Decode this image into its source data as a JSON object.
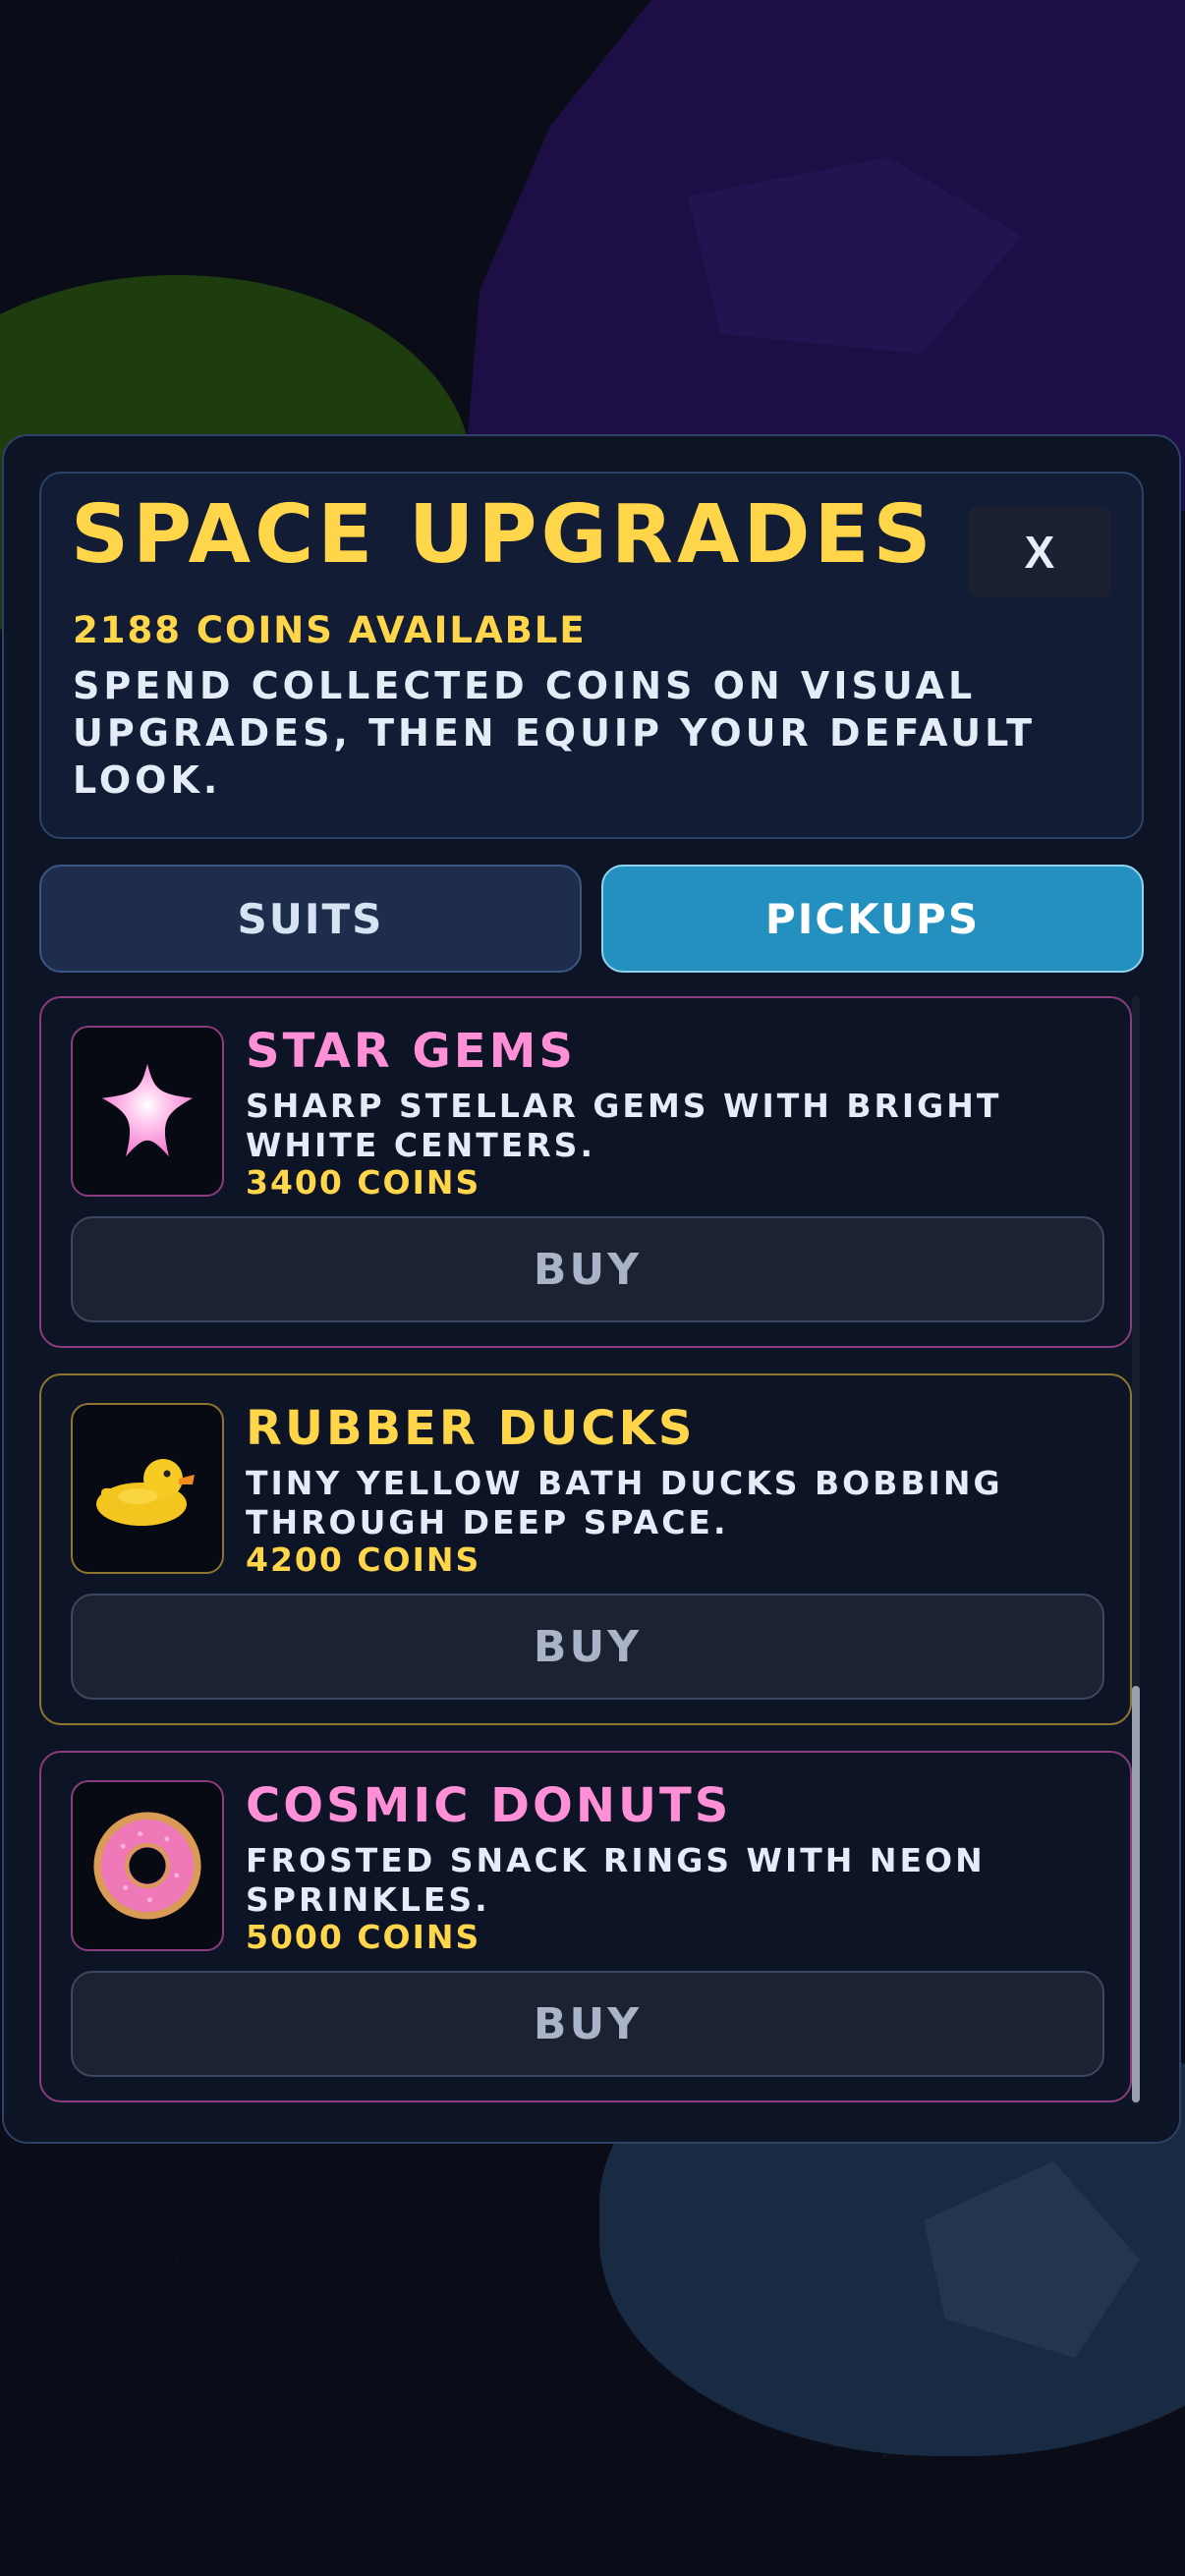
{
  "header": {
    "title": "SPACE UPGRADES",
    "close_label": "X",
    "coins_available": "2188 COINS AVAILABLE",
    "description": "SPEND COLLECTED COINS ON VISUAL UPGRADES, THEN EQUIP YOUR DEFAULT LOOK."
  },
  "tabs": [
    {
      "label": "SUITS",
      "active": false
    },
    {
      "label": "PICKUPS",
      "active": true
    }
  ],
  "items": [
    {
      "name": "STAR GEMS",
      "description": "SHARP STELLAR GEMS WITH BRIGHT WHITE CENTERS.",
      "price": "3400 COINS",
      "button_label": "BUY",
      "icon": "star-gem-icon",
      "accent": "#ff8fd6"
    },
    {
      "name": "RUBBER DUCKS",
      "description": "TINY YELLOW BATH DUCKS BOBBING THROUGH DEEP SPACE.",
      "price": "4200 COINS",
      "button_label": "BUY",
      "icon": "rubber-duck-icon",
      "accent": "#ffd54a"
    },
    {
      "name": "COSMIC DONUTS",
      "description": "FROSTED SNACK RINGS WITH NEON SPRINKLES.",
      "price": "5000 COINS",
      "button_label": "BUY",
      "icon": "donut-icon",
      "accent": "#ff8fd6"
    }
  ],
  "colors": {
    "title": "#ffd54a",
    "coins": "#ffd54a",
    "active_tab": "#2490bf",
    "panel": "#0c1426"
  }
}
